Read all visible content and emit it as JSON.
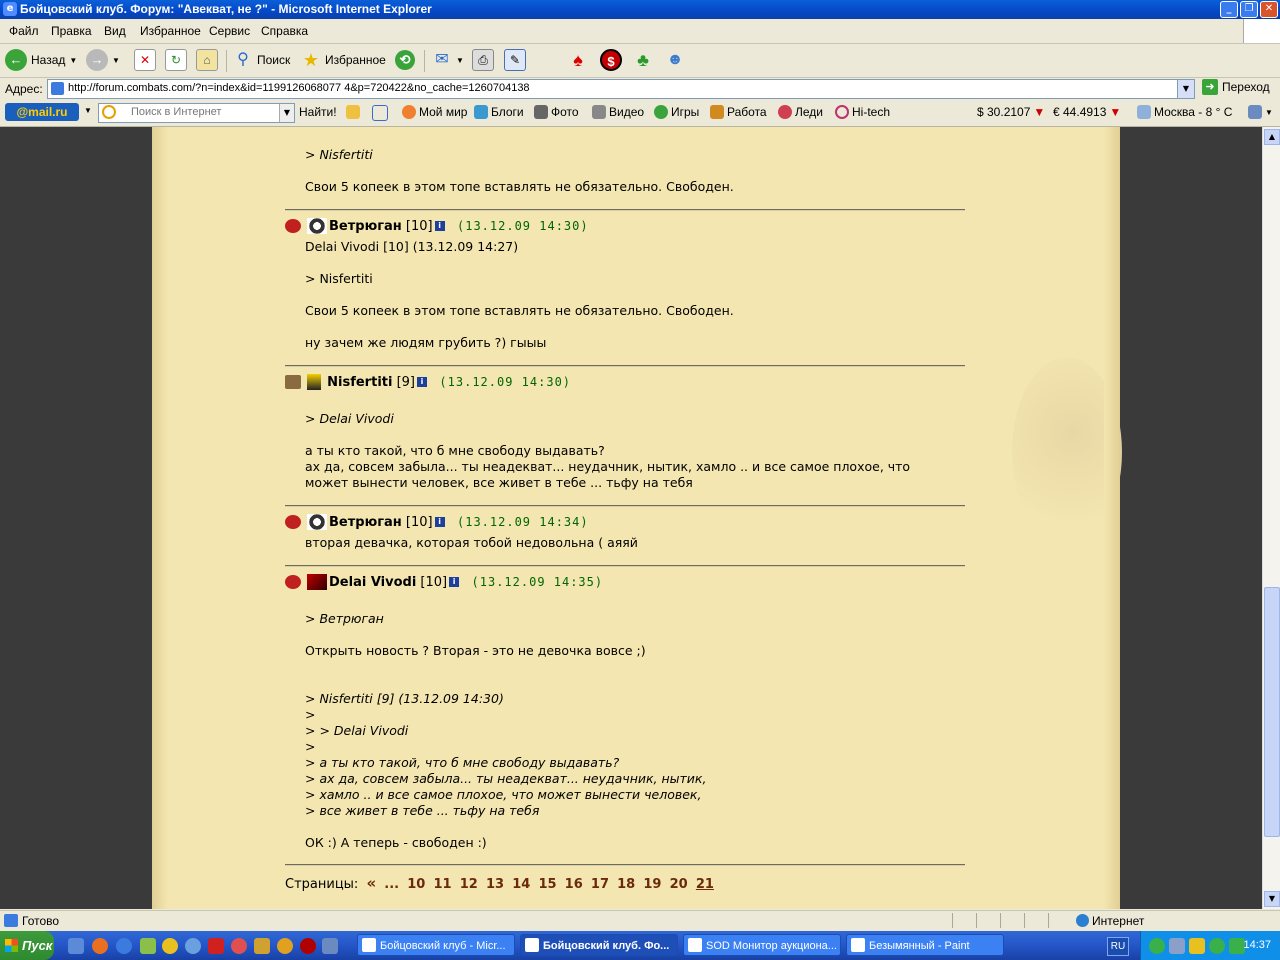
{
  "window": {
    "title": "Бойцовский клуб. Форум: \"Авекват, не ?\" - Microsoft Internet Explorer"
  },
  "menu": [
    "Файл",
    "Правка",
    "Вид",
    "Избранное",
    "Сервис",
    "Справка"
  ],
  "toolbar": {
    "back": "Назад",
    "search": "Поиск",
    "favorites": "Избранное"
  },
  "address": {
    "label": "Адрес:",
    "url": "http://forum.combats.com/?n=index&id=1199126068077 4&p=720422&no_cache=1260704138",
    "go": "Переход"
  },
  "mailbar": {
    "logo": "@mail.ru",
    "search_placeholder": "Поиск в Интернет",
    "find": "Найти!",
    "links": [
      "Мой мир",
      "Блоги",
      "Фото",
      "Видео",
      "Игры",
      "Работа",
      "Леди",
      "Hi-tech"
    ],
    "usd": "$ 30.2107",
    "eur": "€ 44.4913",
    "weather": "Москва - 8 ° C"
  },
  "posts": {
    "top": {
      "quote": "> Nisfertiti",
      "text": "Свои 5 копеек в этом топе вставлять не обязательно. Свободен."
    },
    "p1": {
      "user": "Ветрюган",
      "level": "[10]",
      "date": "(13.12.09 14:30)",
      "l1": "Delai Vivodi [10]   (13.12.09 14:27)",
      "l2": "> Nisfertiti",
      "l3": "Свои 5 копеек в этом топе вставлять не обязательно. Свободен.",
      "l4": "ну зачем же людям грубить ?) гыыы"
    },
    "p2": {
      "user": "Nisfertiti",
      "level": "[9]",
      "date": "(13.12.09 14:30)",
      "l1": "> Delai Vivodi",
      "l2": "а ты кто такой, что б мне свободу выдавать?",
      "l3": "ах да, совсем забыла... ты неадекват... неудачник, нытик, хамло .. и все самое плохое, что",
      "l4": "может вынести человек, все живет в тебе ... тьфу на тебя"
    },
    "p3": {
      "user": "Ветрюган",
      "level": "[10]",
      "date": "(13.12.09 14:34)",
      "l1": "вторая девачка, которая тобой недовольна ( аяяй"
    },
    "p4": {
      "user": "Delai Vivodi",
      "level": "[10]",
      "date": "(13.12.09 14:35)",
      "l1": "> Ветрюган",
      "l2": "Открыть новость ? Вторая - это не девочка вовсе ;)",
      "q1": "> Nisfertiti [9]   (13.12.09 14:30)",
      "q2": ">",
      "q3": "> > Delai Vivodi",
      "q4": ">",
      "q5": "> а ты кто такой, что б мне свободу выдавать?",
      "q6": "> ах да, совсем забыла... ты неадекват... неудачник, нытик,",
      "q7": "> хамло .. и все самое плохое, что может вынести человек,",
      "q8": "> все живет в тебе ... тьфу на тебя",
      "l3": "ОК :) А теперь - свободен :)"
    }
  },
  "pager": {
    "label": "Страницы:",
    "prev": "«",
    "dots": "...",
    "pages": [
      "10",
      "11",
      "12",
      "13",
      "14",
      "15",
      "16",
      "17",
      "18",
      "19",
      "20"
    ],
    "current": "21"
  },
  "status": {
    "text": "Готово",
    "zone": "Интернет"
  },
  "taskbar": {
    "start": "Пуск",
    "tasks": [
      "Бойцовский клуб - Micr...",
      "Бойцовский клуб. Фо...",
      "SOD Монитор аукциона...",
      "Безымянный - Paint"
    ],
    "lang": "RU",
    "clock": "14:37"
  }
}
